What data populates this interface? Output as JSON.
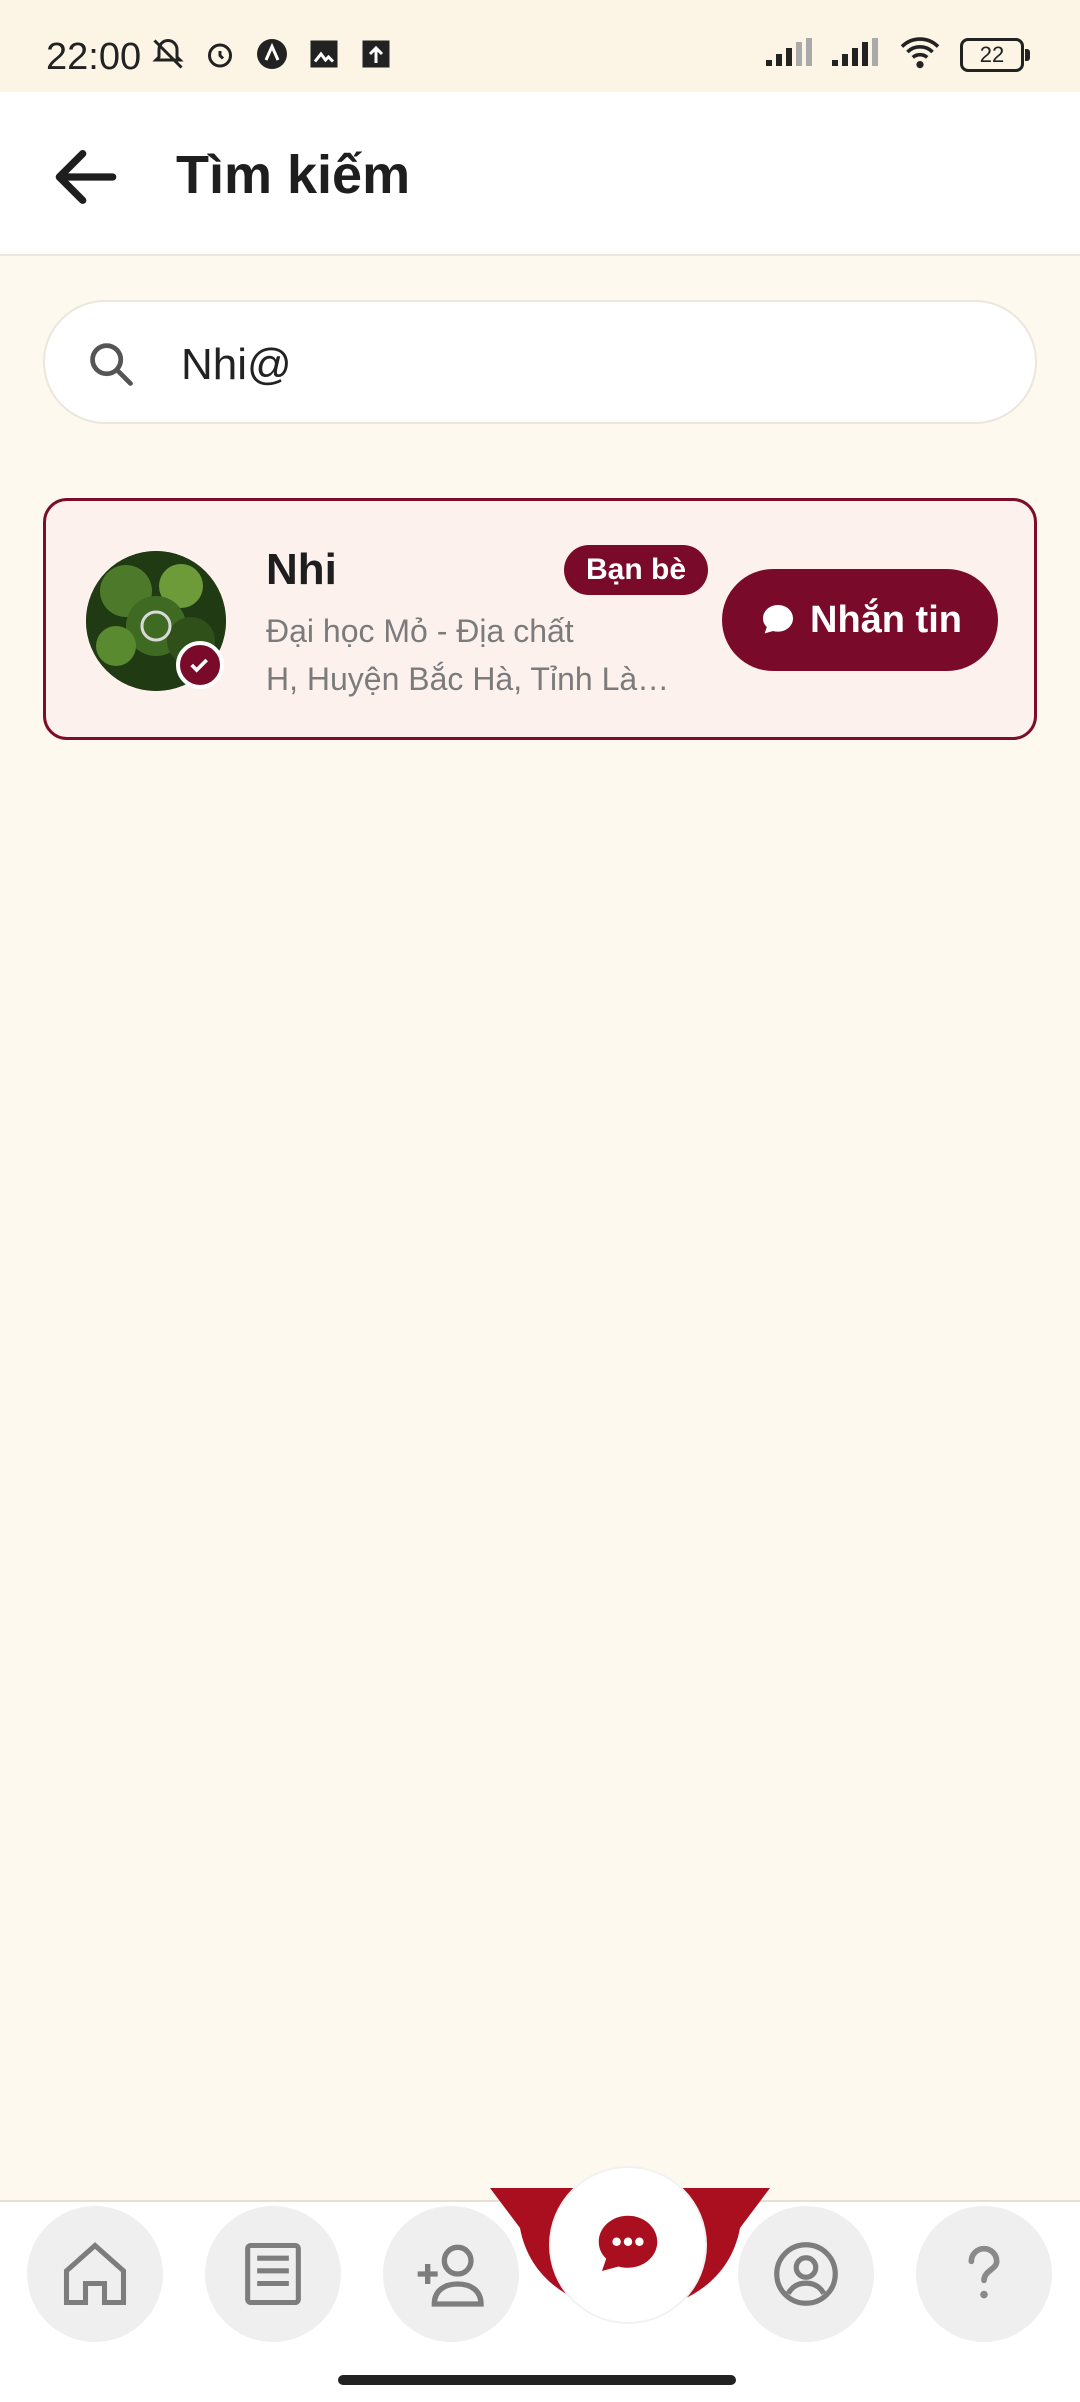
{
  "status_bar": {
    "time": "22:00",
    "battery": "22",
    "icons": [
      "bell-off-icon",
      "alarm-icon",
      "nav-icon",
      "image-icon",
      "upload-icon",
      "signal-icon",
      "signal-icon",
      "wifi-icon",
      "battery-icon"
    ]
  },
  "header": {
    "title": "Tìm kiếm"
  },
  "search": {
    "value": "Nhi@",
    "placeholder": ""
  },
  "result": {
    "name": "Nhi",
    "badge": "Bạn bè",
    "line1": "Đại học Mỏ - Địa chất",
    "line2": "H, Huyện Bắc Hà, Tỉnh Lào ...",
    "message_button": "Nhắn tin"
  },
  "bottom_nav": {
    "items": [
      "home-icon",
      "newspaper-icon",
      "add-friend-icon",
      "chat-icon",
      "profile-icon",
      "help-icon"
    ]
  },
  "colors": {
    "primary": "#7a0a29",
    "background": "#fdf9ee",
    "card_bg": "#fdf1ee"
  }
}
